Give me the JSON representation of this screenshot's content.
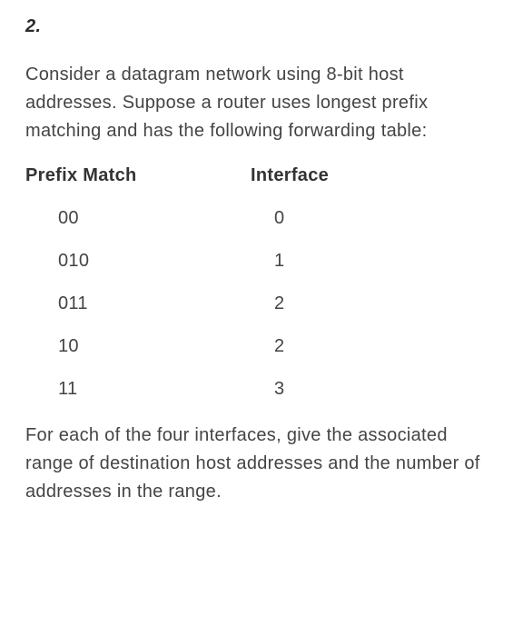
{
  "question_number": "2.",
  "intro_paragraph": "Consider a datagram network using 8-bit host addresses. Suppose a router uses longest prefix matching and has the following forwarding table:",
  "table": {
    "headers": {
      "col1": "Prefix Match",
      "col2": "Interface"
    },
    "rows": [
      {
        "prefix": "00",
        "iface": "0"
      },
      {
        "prefix": "010",
        "iface": "1"
      },
      {
        "prefix": "011",
        "iface": "2"
      },
      {
        "prefix": "10",
        "iface": "2"
      },
      {
        "prefix": "11",
        "iface": "3"
      }
    ]
  },
  "closing_paragraph": "For each of the four interfaces, give the associated range of destination host addresses and the number of addresses in the range."
}
